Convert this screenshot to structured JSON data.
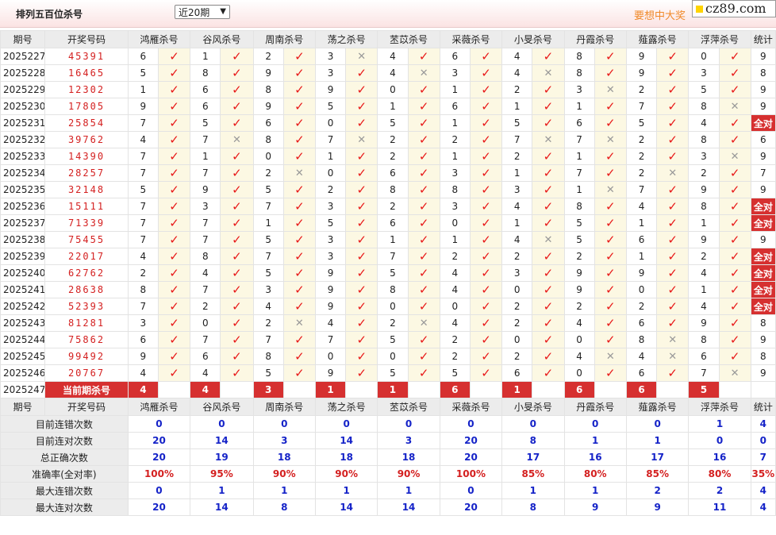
{
  "header": {
    "title": "排列五百位杀号",
    "select_value": "近20期",
    "promo": "要想中大奖",
    "logo": "cz89.com"
  },
  "columns": [
    "期号",
    "开奖号码",
    "鸿雁杀号",
    "谷风杀号",
    "周南杀号",
    "荡之杀号",
    "苤苡杀号",
    "采薇杀号",
    "小旻杀号",
    "丹霞杀号",
    "薤露杀号",
    "浮萍杀号",
    "统计"
  ],
  "rows": [
    {
      "issue": "2025227",
      "num": "45391",
      "k": [
        [
          6,
          1
        ],
        [
          1,
          1
        ],
        [
          2,
          1
        ],
        [
          3,
          0
        ],
        [
          4,
          1
        ],
        [
          6,
          1
        ],
        [
          4,
          1
        ],
        [
          8,
          1
        ],
        [
          9,
          1
        ],
        [
          0,
          1
        ]
      ],
      "s": "9"
    },
    {
      "issue": "2025228",
      "num": "16465",
      "k": [
        [
          5,
          1
        ],
        [
          8,
          1
        ],
        [
          9,
          1
        ],
        [
          3,
          1
        ],
        [
          4,
          0
        ],
        [
          3,
          1
        ],
        [
          4,
          0
        ],
        [
          8,
          1
        ],
        [
          9,
          1
        ],
        [
          3,
          1
        ]
      ],
      "s": "8"
    },
    {
      "issue": "2025229",
      "num": "12302",
      "k": [
        [
          1,
          1
        ],
        [
          6,
          1
        ],
        [
          8,
          1
        ],
        [
          9,
          1
        ],
        [
          0,
          1
        ],
        [
          1,
          1
        ],
        [
          2,
          1
        ],
        [
          3,
          0
        ],
        [
          2,
          1
        ],
        [
          5,
          1
        ]
      ],
      "s": "9"
    },
    {
      "issue": "2025230",
      "num": "17805",
      "k": [
        [
          9,
          1
        ],
        [
          6,
          1
        ],
        [
          9,
          1
        ],
        [
          5,
          1
        ],
        [
          1,
          1
        ],
        [
          6,
          1
        ],
        [
          1,
          1
        ],
        [
          1,
          1
        ],
        [
          7,
          1
        ],
        [
          8,
          0
        ]
      ],
      "s": "9"
    },
    {
      "issue": "2025231",
      "num": "25854",
      "k": [
        [
          7,
          1
        ],
        [
          5,
          1
        ],
        [
          6,
          1
        ],
        [
          0,
          1
        ],
        [
          5,
          1
        ],
        [
          1,
          1
        ],
        [
          5,
          1
        ],
        [
          6,
          1
        ],
        [
          5,
          1
        ],
        [
          4,
          1
        ]
      ],
      "s": "全对"
    },
    {
      "issue": "2025232",
      "num": "39762",
      "k": [
        [
          4,
          1
        ],
        [
          7,
          0
        ],
        [
          8,
          1
        ],
        [
          7,
          0
        ],
        [
          2,
          1
        ],
        [
          2,
          1
        ],
        [
          7,
          0
        ],
        [
          7,
          0
        ],
        [
          2,
          1
        ],
        [
          8,
          1
        ]
      ],
      "s": "6"
    },
    {
      "issue": "2025233",
      "num": "14390",
      "k": [
        [
          7,
          1
        ],
        [
          1,
          1
        ],
        [
          0,
          1
        ],
        [
          1,
          1
        ],
        [
          2,
          1
        ],
        [
          1,
          1
        ],
        [
          2,
          1
        ],
        [
          1,
          1
        ],
        [
          2,
          1
        ],
        [
          3,
          0
        ]
      ],
      "s": "9"
    },
    {
      "issue": "2025234",
      "num": "28257",
      "k": [
        [
          7,
          1
        ],
        [
          7,
          1
        ],
        [
          2,
          0
        ],
        [
          0,
          1
        ],
        [
          6,
          1
        ],
        [
          3,
          1
        ],
        [
          1,
          1
        ],
        [
          7,
          1
        ],
        [
          2,
          0
        ],
        [
          2,
          1
        ]
      ],
      "s": "7"
    },
    {
      "issue": "2025235",
      "num": "32148",
      "k": [
        [
          5,
          1
        ],
        [
          9,
          1
        ],
        [
          5,
          1
        ],
        [
          2,
          1
        ],
        [
          8,
          1
        ],
        [
          8,
          1
        ],
        [
          3,
          1
        ],
        [
          1,
          0
        ],
        [
          7,
          1
        ],
        [
          9,
          1
        ]
      ],
      "s": "9"
    },
    {
      "issue": "2025236",
      "num": "15111",
      "k": [
        [
          7,
          1
        ],
        [
          3,
          1
        ],
        [
          7,
          1
        ],
        [
          3,
          1
        ],
        [
          2,
          1
        ],
        [
          3,
          1
        ],
        [
          4,
          1
        ],
        [
          8,
          1
        ],
        [
          4,
          1
        ],
        [
          8,
          1
        ]
      ],
      "s": "全对"
    },
    {
      "issue": "2025237",
      "num": "71339",
      "k": [
        [
          7,
          1
        ],
        [
          7,
          1
        ],
        [
          1,
          1
        ],
        [
          5,
          1
        ],
        [
          6,
          1
        ],
        [
          0,
          1
        ],
        [
          1,
          1
        ],
        [
          5,
          1
        ],
        [
          1,
          1
        ],
        [
          1,
          1
        ]
      ],
      "s": "全对"
    },
    {
      "issue": "2025238",
      "num": "75455",
      "k": [
        [
          7,
          1
        ],
        [
          7,
          1
        ],
        [
          5,
          1
        ],
        [
          3,
          1
        ],
        [
          1,
          1
        ],
        [
          1,
          1
        ],
        [
          4,
          0
        ],
        [
          5,
          1
        ],
        [
          6,
          1
        ],
        [
          9,
          1
        ]
      ],
      "s": "9"
    },
    {
      "issue": "2025239",
      "num": "22017",
      "k": [
        [
          4,
          1
        ],
        [
          8,
          1
        ],
        [
          7,
          1
        ],
        [
          3,
          1
        ],
        [
          7,
          1
        ],
        [
          2,
          1
        ],
        [
          2,
          1
        ],
        [
          2,
          1
        ],
        [
          1,
          1
        ],
        [
          2,
          1
        ]
      ],
      "s": "全对"
    },
    {
      "issue": "2025240",
      "num": "62762",
      "k": [
        [
          2,
          1
        ],
        [
          4,
          1
        ],
        [
          5,
          1
        ],
        [
          9,
          1
        ],
        [
          5,
          1
        ],
        [
          4,
          1
        ],
        [
          3,
          1
        ],
        [
          9,
          1
        ],
        [
          9,
          1
        ],
        [
          4,
          1
        ]
      ],
      "s": "全对"
    },
    {
      "issue": "2025241",
      "num": "28638",
      "k": [
        [
          8,
          1
        ],
        [
          7,
          1
        ],
        [
          3,
          1
        ],
        [
          9,
          1
        ],
        [
          8,
          1
        ],
        [
          4,
          1
        ],
        [
          0,
          1
        ],
        [
          9,
          1
        ],
        [
          0,
          1
        ],
        [
          1,
          1
        ]
      ],
      "s": "全对"
    },
    {
      "issue": "2025242",
      "num": "52393",
      "k": [
        [
          7,
          1
        ],
        [
          2,
          1
        ],
        [
          4,
          1
        ],
        [
          9,
          1
        ],
        [
          0,
          1
        ],
        [
          0,
          1
        ],
        [
          2,
          1
        ],
        [
          2,
          1
        ],
        [
          2,
          1
        ],
        [
          4,
          1
        ]
      ],
      "s": "全对"
    },
    {
      "issue": "2025243",
      "num": "81281",
      "k": [
        [
          3,
          1
        ],
        [
          0,
          1
        ],
        [
          2,
          0
        ],
        [
          4,
          1
        ],
        [
          2,
          0
        ],
        [
          4,
          1
        ],
        [
          2,
          1
        ],
        [
          4,
          1
        ],
        [
          6,
          1
        ],
        [
          9,
          1
        ]
      ],
      "s": "8"
    },
    {
      "issue": "2025244",
      "num": "75862",
      "k": [
        [
          6,
          1
        ],
        [
          7,
          1
        ],
        [
          7,
          1
        ],
        [
          7,
          1
        ],
        [
          5,
          1
        ],
        [
          2,
          1
        ],
        [
          0,
          1
        ],
        [
          0,
          1
        ],
        [
          8,
          0
        ],
        [
          8,
          1
        ]
      ],
      "s": "9"
    },
    {
      "issue": "2025245",
      "num": "99492",
      "k": [
        [
          9,
          1
        ],
        [
          6,
          1
        ],
        [
          8,
          1
        ],
        [
          0,
          1
        ],
        [
          0,
          1
        ],
        [
          2,
          1
        ],
        [
          2,
          1
        ],
        [
          4,
          0
        ],
        [
          4,
          0
        ],
        [
          6,
          1
        ]
      ],
      "s": "8"
    },
    {
      "issue": "2025246",
      "num": "20767",
      "k": [
        [
          4,
          1
        ],
        [
          4,
          1
        ],
        [
          5,
          1
        ],
        [
          9,
          1
        ],
        [
          5,
          1
        ],
        [
          5,
          1
        ],
        [
          6,
          1
        ],
        [
          0,
          1
        ],
        [
          6,
          1
        ],
        [
          7,
          0
        ]
      ],
      "s": "9"
    }
  ],
  "current": {
    "issue": "2025247",
    "label": "当前期杀号",
    "kills": [
      "4",
      "4",
      "3",
      "1",
      "1",
      "6",
      "1",
      "6",
      "6",
      "5"
    ]
  },
  "stats": [
    {
      "label": "目前连错次数",
      "color": "blue",
      "values": [
        "0",
        "0",
        "0",
        "0",
        "0",
        "0",
        "0",
        "0",
        "0",
        "1",
        "4"
      ]
    },
    {
      "label": "目前连对次数",
      "color": "blue",
      "values": [
        "20",
        "14",
        "3",
        "14",
        "3",
        "20",
        "8",
        "1",
        "1",
        "0",
        "0"
      ]
    },
    {
      "label": "总正确次数",
      "color": "blue",
      "values": [
        "20",
        "19",
        "18",
        "18",
        "18",
        "20",
        "17",
        "16",
        "17",
        "16",
        "7"
      ]
    },
    {
      "label": "准确率(全对率)",
      "color": "red",
      "values": [
        "100%",
        "95%",
        "90%",
        "90%",
        "90%",
        "100%",
        "85%",
        "80%",
        "85%",
        "80%",
        "35%"
      ]
    },
    {
      "label": "最大连错次数",
      "color": "blue",
      "values": [
        "0",
        "1",
        "1",
        "1",
        "1",
        "0",
        "1",
        "1",
        "2",
        "2",
        "4"
      ]
    },
    {
      "label": "最大连对次数",
      "color": "blue",
      "values": [
        "20",
        "14",
        "8",
        "14",
        "14",
        "20",
        "8",
        "9",
        "9",
        "11",
        "4"
      ]
    }
  ],
  "marks": {
    "ok": "✓",
    "no": "✕"
  }
}
